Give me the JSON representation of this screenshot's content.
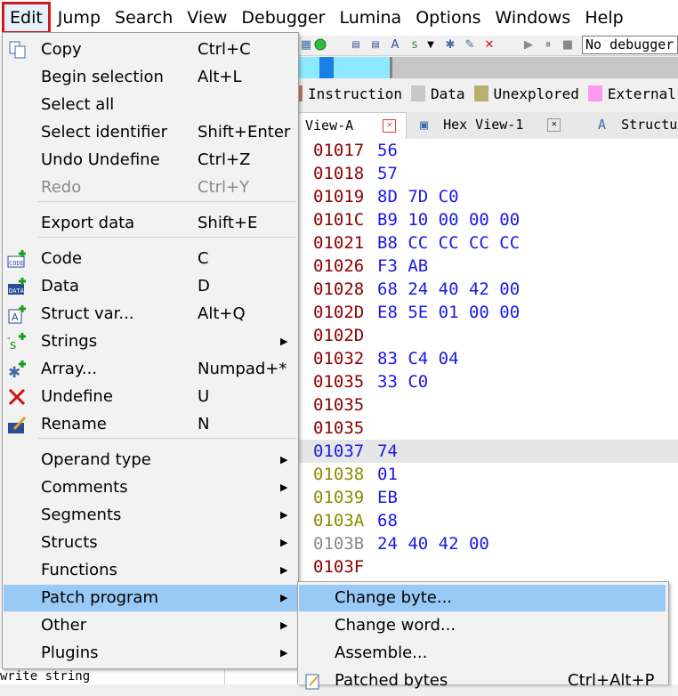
{
  "menubar": {
    "items": [
      "Edit",
      "Jump",
      "Search",
      "View",
      "Debugger",
      "Lumina",
      "Options",
      "Windows",
      "Help"
    ]
  },
  "toolbar": {
    "debugger_select": "No debugger"
  },
  "legend": {
    "items": [
      {
        "label": "Instruction",
        "color": "#c0805a"
      },
      {
        "label": "Data",
        "color": "#c8c8c8"
      },
      {
        "label": "Unexplored",
        "color": "#b8b070"
      },
      {
        "label": "External",
        "color": "#ff99ee"
      }
    ]
  },
  "tabs": [
    {
      "label": "View-A"
    },
    {
      "label": "Hex View-1"
    },
    {
      "label": "Structu"
    }
  ],
  "code": [
    {
      "addr": "01017",
      "bytes": "56",
      "addr_color": "#8b0000"
    },
    {
      "addr": "01018",
      "bytes": "57",
      "addr_color": "#8b0000"
    },
    {
      "addr": "01019",
      "bytes": "8D 7D C0",
      "addr_color": "#8b0000"
    },
    {
      "addr": "0101C",
      "bytes": "B9 10 00 00 00",
      "addr_color": "#8b0000"
    },
    {
      "addr": "01021",
      "bytes": "B8 CC CC CC CC",
      "addr_color": "#8b0000"
    },
    {
      "addr": "01026",
      "bytes": "F3 AB",
      "addr_color": "#8b0000"
    },
    {
      "addr": "01028",
      "bytes": "68 24 40 42 00",
      "addr_color": "#8b0000"
    },
    {
      "addr": "0102D",
      "bytes": "E8 5E 01 00 00",
      "addr_color": "#8b0000"
    },
    {
      "addr": "0102D",
      "bytes": "",
      "addr_color": "#8b0000"
    },
    {
      "addr": "01032",
      "bytes": "83 C4 04",
      "addr_color": "#8b0000"
    },
    {
      "addr": "01035",
      "bytes": "33 C0",
      "addr_color": "#8b0000"
    },
    {
      "addr": "01035",
      "bytes": "",
      "addr_color": "#8b0000"
    },
    {
      "addr": "01035",
      "bytes": "",
      "addr_color": "#8b0000"
    },
    {
      "addr": "01037",
      "bytes": "74",
      "addr_color": "#1a1ae6"
    },
    {
      "addr": "01038",
      "bytes": "01",
      "addr_color": "#8b8b00"
    },
    {
      "addr": "01039",
      "bytes": "EB",
      "addr_color": "#8b8b00"
    },
    {
      "addr": "0103A",
      "bytes": "68",
      "addr_color": "#8b8b00"
    },
    {
      "addr": "0103B",
      "bytes": "24 40 42 00",
      "addr_color": "#8a8a8a"
    },
    {
      "addr": "0103F",
      "bytes": "",
      "addr_color": "#8b0000"
    }
  ],
  "output_text": "write string",
  "edit_menu": {
    "items": [
      {
        "label": "Copy",
        "shortcut": "Ctrl+C",
        "icon": "copy-icon"
      },
      {
        "label": "Begin selection",
        "shortcut": "Alt+L"
      },
      {
        "label": "Select all",
        "shortcut": ""
      },
      {
        "label": "Select identifier",
        "shortcut": "Shift+Enter"
      },
      {
        "label": "Undo Undefine",
        "shortcut": "Ctrl+Z"
      },
      {
        "label": "Redo",
        "shortcut": "Ctrl+Y",
        "disabled": true
      },
      {
        "label": "Export data",
        "shortcut": "Shift+E"
      },
      {
        "label": "Code",
        "shortcut": "C",
        "icon": "code-icon"
      },
      {
        "label": "Data",
        "shortcut": "D",
        "icon": "data-icon"
      },
      {
        "label": "Struct var...",
        "shortcut": "Alt+Q",
        "icon": "struct-var-icon"
      },
      {
        "label": "Strings",
        "shortcut": "",
        "icon": "strings-icon",
        "submenu": true
      },
      {
        "label": "Array...",
        "shortcut": "Numpad+*",
        "icon": "array-icon"
      },
      {
        "label": "Undefine",
        "shortcut": "U",
        "icon": "undefine-icon"
      },
      {
        "label": "Rename",
        "shortcut": "N",
        "icon": "rename-icon"
      },
      {
        "label": "Operand type",
        "submenu": true
      },
      {
        "label": "Comments",
        "submenu": true
      },
      {
        "label": "Segments",
        "submenu": true
      },
      {
        "label": "Structs",
        "submenu": true
      },
      {
        "label": "Functions",
        "submenu": true
      },
      {
        "label": "Patch program",
        "submenu": true,
        "highlighted": true
      },
      {
        "label": "Other",
        "submenu": true
      },
      {
        "label": "Plugins",
        "submenu": true
      }
    ]
  },
  "patch_submenu": {
    "items": [
      {
        "label": "Change byte...",
        "shortcut": "",
        "highlighted": true
      },
      {
        "label": "Change word...",
        "shortcut": ""
      },
      {
        "label": "Assemble...",
        "shortcut": ""
      },
      {
        "label": "Patched bytes",
        "shortcut": "Ctrl+Alt+P",
        "icon": "patched-bytes-icon"
      }
    ]
  }
}
